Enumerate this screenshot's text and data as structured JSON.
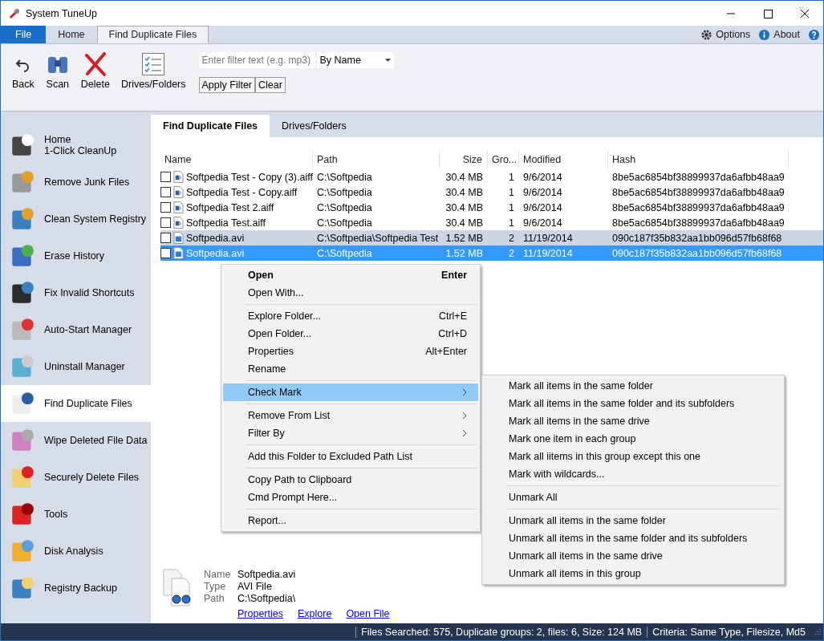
{
  "window": {
    "title": "System TuneUp"
  },
  "ribbon_tabs": [
    {
      "label": "File",
      "kind": "file",
      "selected": false
    },
    {
      "label": "Home",
      "kind": "tab",
      "selected": false
    },
    {
      "label": "Find Duplicate Files",
      "kind": "tab",
      "selected": true
    }
  ],
  "help_links": [
    "Options",
    "About"
  ],
  "toolbar": [
    {
      "label": "Back",
      "kind": "back"
    },
    {
      "label": "Scan",
      "kind": "scan"
    },
    {
      "label": "Delete",
      "kind": "delete"
    },
    {
      "label": "Drives/Folders",
      "kind": "list"
    }
  ],
  "filter": {
    "placeholder": "Enter filter text (e.g. mp3)",
    "sort": "By Name",
    "buttons": [
      "Apply Filter",
      "Clear"
    ]
  },
  "sidebar": [
    {
      "label": "Home",
      "sublabel": "1-Click CleanUp",
      "selected": false
    },
    {
      "label": "Remove Junk Files",
      "selected": false
    },
    {
      "label": "Clean System Registry",
      "selected": false
    },
    {
      "label": "Erase History",
      "selected": false
    },
    {
      "label": "Fix Invalid Shortcuts",
      "selected": false
    },
    {
      "label": "Auto-Start Manager",
      "selected": false
    },
    {
      "label": "Uninstall Manager",
      "selected": false
    },
    {
      "label": "Find Duplicate Files",
      "selected": true
    },
    {
      "label": "Wipe Deleted File Data",
      "selected": false
    },
    {
      "label": "Securely Delete Files",
      "selected": false
    },
    {
      "label": "Tools",
      "selected": false
    },
    {
      "label": "Disk Analysis",
      "selected": false
    },
    {
      "label": "Registry Backup",
      "selected": false
    }
  ],
  "content_tabs": [
    {
      "label": "Find Duplicate Files",
      "selected": true
    },
    {
      "label": "Drives/Folders",
      "selected": false
    }
  ],
  "table": {
    "columns": [
      "Name",
      "Path",
      "Size",
      "Gro...",
      "Modified",
      "Hash"
    ],
    "rows": [
      {
        "kind": "audio",
        "checked": false,
        "hot": false,
        "selected": false,
        "cells": [
          "Softpedia Test - Copy (3).aiff",
          "C:\\Softpedia",
          "30.4 MB",
          "1",
          "9/6/2014",
          "8be5ac6854bf38899937da6afbb48aa9"
        ]
      },
      {
        "kind": "audio",
        "checked": false,
        "hot": false,
        "selected": false,
        "cells": [
          "Softpedia Test - Copy.aiff",
          "C:\\Softpedia",
          "30.4 MB",
          "1",
          "9/6/2014",
          "8be5ac6854bf38899937da6afbb48aa9"
        ]
      },
      {
        "kind": "audio",
        "checked": false,
        "hot": false,
        "selected": false,
        "cells": [
          "Softpedia Test 2.aiff",
          "C:\\Softpedia",
          "30.4 MB",
          "1",
          "9/6/2014",
          "8be5ac6854bf38899937da6afbb48aa9"
        ]
      },
      {
        "kind": "audio",
        "checked": false,
        "hot": false,
        "selected": false,
        "cells": [
          "Softpedia Test.aiff",
          "C:\\Softpedia",
          "30.4 MB",
          "1",
          "9/6/2014",
          "8be5ac6854bf38899937da6afbb48aa9"
        ]
      },
      {
        "kind": "video",
        "checked": false,
        "hot": true,
        "selected": false,
        "cells": [
          "Softpedia.avi",
          "C:\\Softpedia\\Softpedia Test",
          "1.52 MB",
          "2",
          "11/19/2014",
          "090c187f35b832aa1bb096d57fb68f68"
        ]
      },
      {
        "kind": "video",
        "checked": false,
        "hot": false,
        "selected": true,
        "cells": [
          "Softpedia.avi",
          "C:\\Softpedia",
          "1.52 MB",
          "2",
          "11/19/2014",
          "090c187f35b832aa1bb096d57fb68f68"
        ]
      }
    ]
  },
  "context_menu": {
    "sections": [
      [
        {
          "label": "Open",
          "shortcut": "Enter",
          "bold": true,
          "submenu": false,
          "highlighted": false
        },
        {
          "label": "Open With...",
          "bold": false,
          "submenu": false,
          "highlighted": false
        }
      ],
      [
        {
          "label": "Explore Folder...",
          "shortcut": "Ctrl+E",
          "bold": false,
          "submenu": false,
          "highlighted": false
        },
        {
          "label": "Open Folder...",
          "shortcut": "Ctrl+D",
          "bold": false,
          "submenu": false,
          "highlighted": false
        },
        {
          "label": "Properties",
          "shortcut": "Alt+Enter",
          "bold": false,
          "submenu": false,
          "highlighted": false
        },
        {
          "label": "Rename",
          "bold": false,
          "submenu": false,
          "highlighted": false
        }
      ],
      [
        {
          "label": "Check Mark",
          "bold": false,
          "submenu": true,
          "highlighted": true
        }
      ],
      [
        {
          "label": "Remove From List",
          "bold": false,
          "submenu": true,
          "highlighted": false
        },
        {
          "label": "Filter By",
          "bold": false,
          "submenu": true,
          "highlighted": false
        }
      ],
      [
        {
          "label": "Add this Folder to Excluded Path List",
          "bold": false,
          "submenu": false,
          "highlighted": false
        }
      ],
      [
        {
          "label": "Copy Path to Clipboard",
          "bold": false,
          "submenu": false,
          "highlighted": false
        },
        {
          "label": "Cmd Prompt Here...",
          "bold": false,
          "submenu": false,
          "highlighted": false
        }
      ],
      [
        {
          "label": "Report...",
          "bold": false,
          "submenu": false,
          "highlighted": false
        }
      ]
    ]
  },
  "submenu": {
    "sections": [
      [
        "Mark all items in the same folder",
        "Mark all items in the same folder and its subfolders",
        "Mark all items in the same drive",
        "Mark one item in each group",
        "Mark all iitems in this group except this one",
        "Mark with wildcards..."
      ],
      [
        "Unmark All"
      ],
      [
        "Unmark all items in the same folder",
        "Unmark all items in the same folder and its subfolders",
        "Unmark all items in the same drive",
        "Unmark all items in this group"
      ]
    ]
  },
  "details": {
    "fields": [
      {
        "label": "Name",
        "value": "Softpedia.avi"
      },
      {
        "label": "Type",
        "value": "AVI File"
      },
      {
        "label": "Path",
        "value": "C:\\Softpedia\\"
      }
    ],
    "links": [
      "Properties",
      "Explore",
      "Open File"
    ]
  },
  "status_bar": [
    "Files Searched: 575,  Duplicate groups: 2, files: 6, Size: 124 MB",
    "Criteria: Same Type, Filesize, Md5"
  ]
}
